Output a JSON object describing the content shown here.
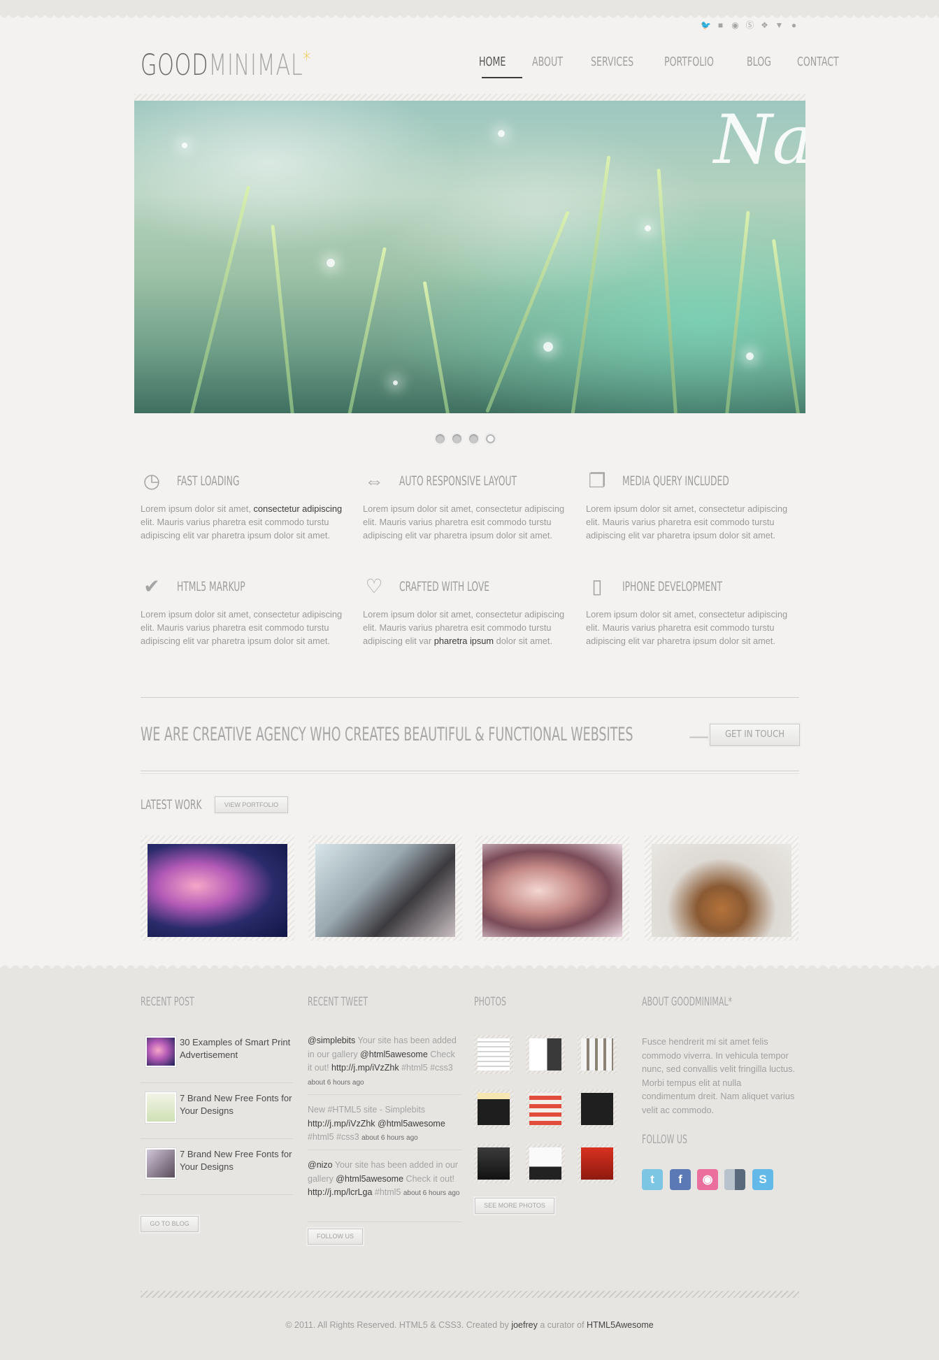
{
  "header": {
    "logo": {
      "good": "GOOD",
      "minimal": "MINIMAL",
      "star": "*"
    },
    "social_icons": [
      "twitter-icon",
      "flickr-icon",
      "dribbble-icon",
      "skype-icon",
      "dropbox-icon",
      "vimeo-icon",
      "myspace-icon"
    ],
    "nav": [
      "HOME",
      "ABOUT",
      "SERVICES",
      "PORTFOLIO",
      "BLOG",
      "CONTACT"
    ],
    "active_nav": "HOME"
  },
  "hero": {
    "script_text": "Na",
    "slides": 4,
    "active_slide": 4
  },
  "features": [
    {
      "icon": "clock-icon",
      "title": "FAST LOADING",
      "pre": "Lorem ipsum dolor sit amet, ",
      "hl": "consectetur adipiscing",
      "post": " elit. Mauris varius pharetra esit commodo turstu adipiscing elit var pharetra ipsum dolor sit amet."
    },
    {
      "icon": "arrows-icon",
      "title": "AUTO RESPONSIVE LAYOUT",
      "pre": "Lorem ipsum dolor sit amet, consectetur adipiscing elit. Mauris varius pharetra esit commodo turstu adipiscing elit var pharetra ipsum dolor sit amet.",
      "hl": "",
      "post": ""
    },
    {
      "icon": "windows-icon",
      "title": "MEDIA QUERY INCLUDED",
      "pre": "Lorem ipsum dolor sit amet, consectetur adipiscing elit. Mauris varius pharetra esit commodo turstu adipiscing elit var pharetra ipsum dolor sit amet.",
      "hl": "",
      "post": ""
    },
    {
      "icon": "check-icon",
      "title": "HTML5 MARKUP",
      "pre": "Lorem ipsum dolor sit amet, consectetur adipiscing elit. Mauris varius pharetra esit commodo turstu adipiscing elit var pharetra ipsum dolor sit amet.",
      "hl": "",
      "post": ""
    },
    {
      "icon": "heart-icon",
      "title": "CRAFTED WITH LOVE",
      "pre": "Lorem ipsum dolor sit amet, consectetur adipiscing elit. Mauris varius pharetra esit commodo turstu adipiscing elit var ",
      "hl": "pharetra ipsum",
      "post": " dolor sit amet."
    },
    {
      "icon": "iphone-icon",
      "title": "IPHONE DEVELOPMENT",
      "pre": "Lorem ipsum dolor sit amet, consectetur adipiscing elit. Mauris varius pharetra esit commodo turstu adipiscing elit var pharetra ipsum dolor sit amet.",
      "hl": "",
      "post": ""
    }
  ],
  "callout": {
    "text": "WE ARE CREATIVE AGENCY WHO CREATES BEAUTIFUL & FUNCTIONAL WEBSITES",
    "button": "GET IN TOUCH"
  },
  "latest_work": {
    "title": "LATEST WORK",
    "button": "VIEW PORTFOLIO",
    "items": [
      "jellyfish",
      "zebra",
      "woman",
      "desk"
    ]
  },
  "footer": {
    "recent_post": {
      "title": "RECENT POST",
      "posts": [
        "30 Examples of Smart Print Advertisement",
        "7 Brand New Free Fonts for Your Designs",
        "7 Brand New Free Fonts for Your Designs"
      ],
      "button": "GO TO BLOG"
    },
    "recent_tweet": {
      "title": "RECENT TWEET",
      "tweets": [
        {
          "user": "@simplebits",
          "a": " Your site has been added in our gallery ",
          "mention": "@html5awesome",
          "b": " Check it out! ",
          "link": "http://j.mp/iVzZhk",
          "tags": " #html5 #css3 ",
          "time": "about 6 hours ago"
        },
        {
          "user": "",
          "a": "New #HTML5 site - Simplebits ",
          "mention": "http://j.mp/iVzZhk @html5awesome",
          "b": "",
          "link": "",
          "tags": " #html5 #css3 ",
          "time": "about 6 hours ago"
        },
        {
          "user": "@nizo",
          "a": " Your site has been added in our gallery ",
          "mention": "@html5awesome",
          "b": " Check it out! ",
          "link": "http://j.mp/lcrLga",
          "tags": " #html5 ",
          "time": "about 6 hours ago"
        }
      ],
      "button": "FOLLOW US"
    },
    "photos": {
      "title": "PHOTOS",
      "button": "SEE MORE PHOTOS"
    },
    "about": {
      "title": "ABOUT GOODMINIMAL*",
      "text": "Fusce hendrerit mi sit amet felis commodo viverra. In vehicula tempor nunc, sed convallis velit fringilla luctus. Morbi tempus elit at nulla condimentum dreit. Nam aliquet varius velit ac commodo.",
      "follow_title": "FOLLOW US",
      "icons": [
        "twitter-icon",
        "facebook-icon",
        "dribbble-icon",
        "delicious-icon",
        "skype-icon"
      ]
    },
    "copyright": {
      "pre": "© 2011. All Rights Reserved. HTML5 & CSS3. Created by ",
      "author": "joefrey",
      "mid": " a curator of ",
      "site": "HTML5Awesome"
    }
  }
}
